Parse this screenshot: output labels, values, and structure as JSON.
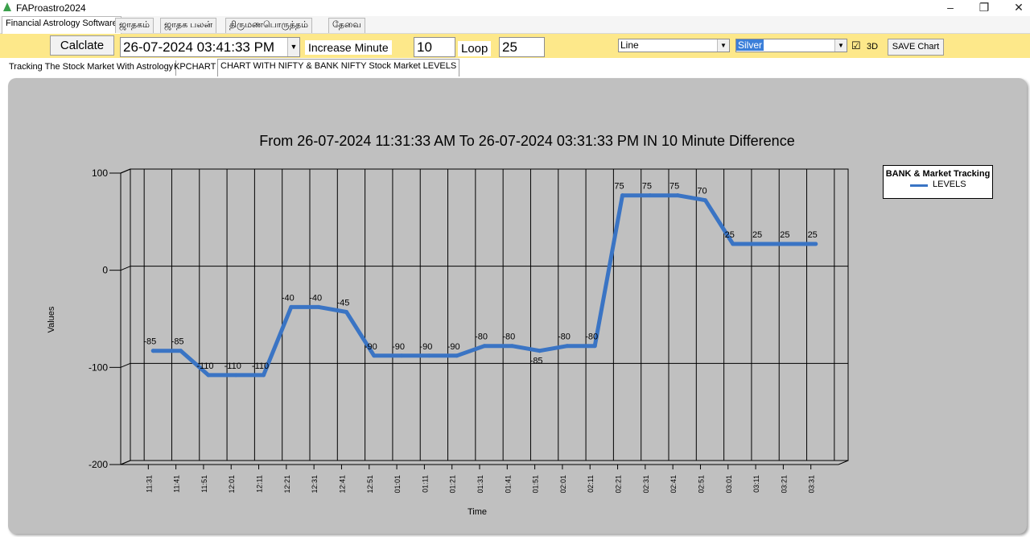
{
  "app": {
    "title": "FAProastro2024",
    "minimize": "–",
    "restore": "❐",
    "close": "✕"
  },
  "main_tabs": [
    "Financial Astrology Software",
    "ஜாதகம்",
    "ஜாதக பலன்",
    "திருமணபொருத்தம்",
    "தேவை"
  ],
  "toolbar": {
    "calc_label": "Calclate",
    "datetime_value": "26-07-2024 03:41:33 PM",
    "increase_label": "Increase Minute",
    "minute_value": "10",
    "loop_label": "Loop",
    "loop_value": "25",
    "chart_type_value": "Line",
    "color_value": "Silver",
    "check_mark": "☑",
    "threed_label": "3D",
    "save_label": "SAVE Chart"
  },
  "sub_tabs": [
    "Tracking The Stock Market With Astrology",
    "KPCHART",
    "CHART WITH NIFTY & BANK NIFTY Stock Market LEVELS"
  ],
  "chart_data": {
    "type": "line",
    "title": "From 26-07-2024 11:31:33 AM To 26-07-2024 03:31:33 PM  IN  10  Minute Difference",
    "xlabel": "Time",
    "ylabel": "Values",
    "ylim": [
      -200,
      100
    ],
    "yticks": [
      100,
      0,
      -100,
      -200
    ],
    "grid": true,
    "legend": {
      "title": "BANK & Market Tracking",
      "placement": "top-right"
    },
    "categories": [
      "11:31",
      "11:41",
      "11:51",
      "12:01",
      "12:11",
      "12:21",
      "12:31",
      "12:41",
      "12:51",
      "01:01",
      "01:11",
      "01:21",
      "01:31",
      "01:41",
      "01:51",
      "02:01",
      "02:11",
      "02:21",
      "02:31",
      "02:41",
      "02:51",
      "03:01",
      "03:11",
      "03:21",
      "03:31"
    ],
    "series": [
      {
        "name": "LEVELS",
        "color": "#3a74c4",
        "values": [
          -85,
          -85,
          -110,
          -110,
          -110,
          -40,
          -40,
          -45,
          -90,
          -90,
          -90,
          -90,
          -80,
          -80,
          -85,
          -80,
          -80,
          75,
          75,
          75,
          70,
          25,
          25,
          25,
          25
        ]
      }
    ]
  }
}
